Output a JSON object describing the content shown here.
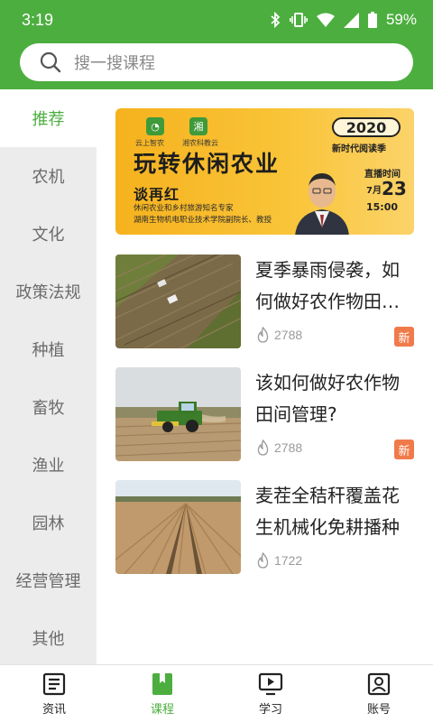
{
  "colors": {
    "brand": "#4cae3f",
    "badge": "#f07a4a",
    "banner": "#f9c53a"
  },
  "status": {
    "time": "3:19",
    "battery": "59%"
  },
  "search": {
    "placeholder": "搜一搜课程"
  },
  "sidebar": {
    "items": [
      {
        "label": "推荐",
        "active": true
      },
      {
        "label": "农机"
      },
      {
        "label": "文化"
      },
      {
        "label": "政策法规"
      },
      {
        "label": "种植"
      },
      {
        "label": "畜牧"
      },
      {
        "label": "渔业"
      },
      {
        "label": "园林"
      },
      {
        "label": "经营管理"
      },
      {
        "label": "其他"
      }
    ]
  },
  "banner": {
    "logo1": "云上智农",
    "logo2": "湘农科教云",
    "year": "2020",
    "season": "新时代阅读季",
    "title": "玩转休闲农业",
    "speaker": "谈再红",
    "desc1": "休闲农业和乡村旅游知名专家",
    "desc2": "湖南生物机电职业技术学院副院长、教授",
    "live_label": "直播时间",
    "month": "7月",
    "day": "23",
    "time": "15:00"
  },
  "courses": [
    {
      "title": "夏季暴雨侵袭，如何做好农作物田间管理？",
      "views": "2788",
      "badge": "新",
      "thumb": "aerial-harvest-field"
    },
    {
      "title": "该如何做好农作物田间管理?",
      "views": "2788",
      "badge": "新",
      "thumb": "combine-harvester"
    },
    {
      "title": "麦茬全秸秆覆盖花生机械化免耕播种",
      "views": "1722",
      "badge": "",
      "thumb": "wheat-stubble-field"
    }
  ],
  "bottom_nav": [
    {
      "label": "资讯",
      "icon": "news-icon"
    },
    {
      "label": "课程",
      "icon": "course-icon",
      "active": true
    },
    {
      "label": "学习",
      "icon": "study-icon"
    },
    {
      "label": "账号",
      "icon": "account-icon"
    }
  ]
}
